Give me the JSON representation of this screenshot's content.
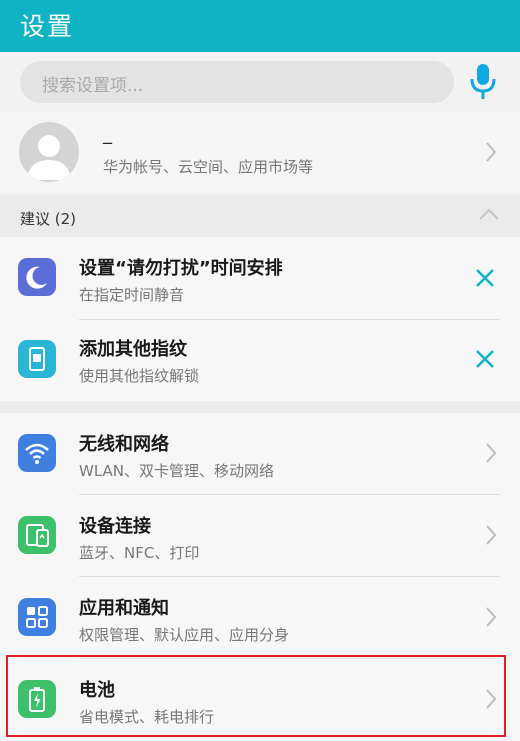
{
  "header": {
    "title": "设置"
  },
  "search": {
    "placeholder": "搜索设置项..."
  },
  "account": {
    "name": "_",
    "subtitle": "华为帐号、云空间、应用市场等"
  },
  "suggestions": {
    "title": "建议 (2)",
    "items": [
      {
        "title": "设置“请勿打扰”时间安排",
        "subtitle": "在指定时间静音",
        "icon": "moon-icon",
        "color": "#5b6ed8"
      },
      {
        "title": "添加其他指纹",
        "subtitle": "使用其他指纹解锁",
        "icon": "fingerprint-phone-icon",
        "color": "#29b6d6"
      }
    ]
  },
  "settings": [
    {
      "title": "无线和网络",
      "subtitle": "WLAN、双卡管理、移动网络",
      "icon": "wifi-icon",
      "color": "#3f7fe0"
    },
    {
      "title": "设备连接",
      "subtitle": "蓝牙、NFC、打印",
      "icon": "device-connect-icon",
      "color": "#3cc06a"
    },
    {
      "title": "应用和通知",
      "subtitle": "权限管理、默认应用、应用分身",
      "icon": "apps-icon",
      "color": "#3f7fe0"
    },
    {
      "title": "电池",
      "subtitle": "省电模式、耗电排行",
      "icon": "battery-icon",
      "color": "#3cc06a"
    }
  ],
  "colors": {
    "header": "#0fb3c3",
    "accent": "#0fb3c3",
    "highlight": "#e02020"
  }
}
